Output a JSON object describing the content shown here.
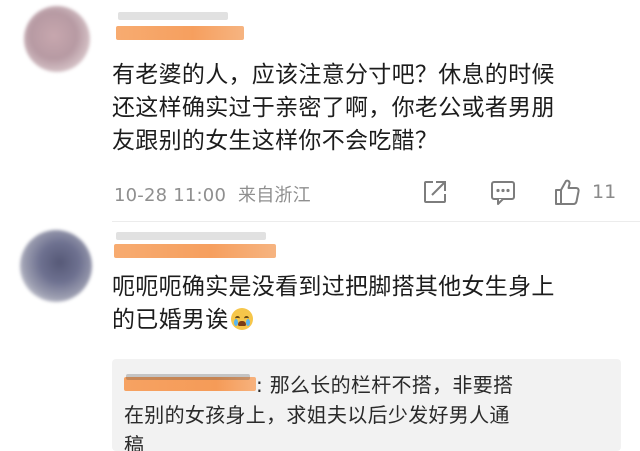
{
  "comments": [
    {
      "lines": [
        "有老婆的人，应该注意分寸吧？休息的时候",
        "还这样确实过于亲密了啊，你老公或者男朋",
        "友跟别的女生这样你不会吃醋？"
      ],
      "timestamp": "10-28 11:00",
      "location": "来自浙江",
      "like_count": "11",
      "avatar_icon": "blurred-pink-avatar"
    },
    {
      "lines": [
        "呃呃呃确实是没看到过把脚搭其他女生身上",
        "的已婚男诶"
      ],
      "emoji": "crying-face-emoji",
      "reply": {
        "lines": [
          ": 那么长的栏杆不搭，非要搭",
          "在别的女孩身上，求姐夫以后少发好男人通",
          "稿"
        ]
      },
      "avatar_icon": "blurred-purple-avatar"
    }
  ],
  "colors": {
    "redaction": "#f59a56",
    "meta_text": "#8f8f8f",
    "reply_bg": "#f2f2f2"
  }
}
